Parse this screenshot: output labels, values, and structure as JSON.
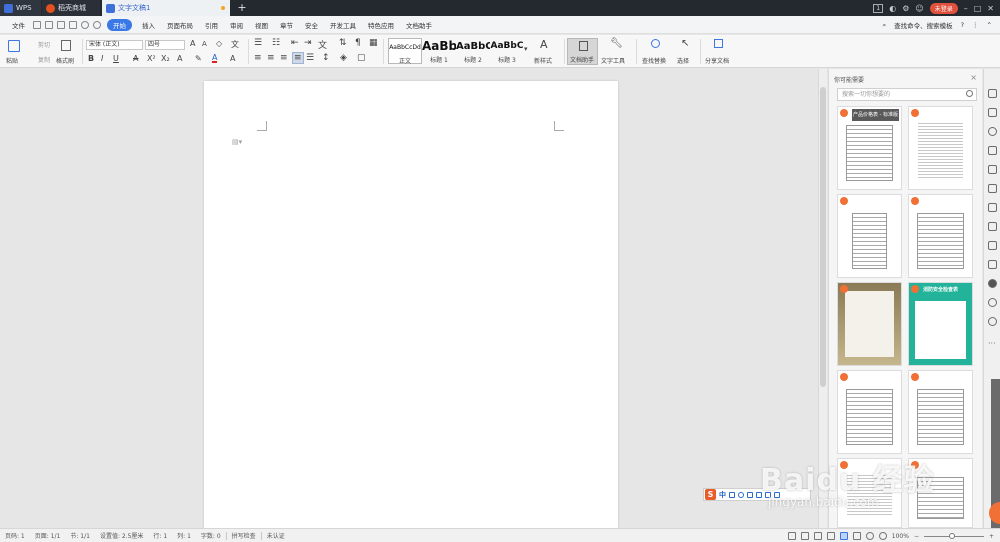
{
  "titlebar": {
    "tabs": [
      {
        "label": "WPS"
      },
      {
        "label": "稻壳商城"
      },
      {
        "label": "文字文稿1"
      }
    ],
    "new_tab": "+",
    "user_badge": "1",
    "login": "未登录"
  },
  "menubar": {
    "file": "文件",
    "items": [
      "开始",
      "插入",
      "页面布局",
      "引用",
      "审阅",
      "视图",
      "章节",
      "安全",
      "开发工具",
      "特色应用",
      "文档助手"
    ],
    "search": "查找命令、搜索模板",
    "help": "?"
  },
  "ribbon": {
    "paste": "粘贴",
    "cut": "剪切",
    "copy": "复制",
    "format_painter": "格式刷",
    "font": "宋体 (正文)",
    "size": "四号",
    "styles": [
      {
        "preview": "AaBbCcDd",
        "name": "正文"
      },
      {
        "preview": "AaBb",
        "name": "标题 1"
      },
      {
        "preview": "AaBbC",
        "name": "标题 2"
      },
      {
        "preview": "AaBbC",
        "name": "标题 3"
      }
    ],
    "new_style": "新样式",
    "doc_assistant": "文档助手",
    "text_tools": "文字工具",
    "find_replace": "查找替换",
    "select": "选择",
    "share": "分享文档"
  },
  "panel": {
    "title": "你可能需要",
    "search_placeholder": "搜索一切你想要的",
    "templates": [
      {
        "header": "产品价格表 - 标准版"
      },
      {
        "header": ""
      },
      {
        "header": ""
      },
      {
        "header": ""
      },
      {
        "header": ""
      },
      {
        "header": "消防安全检查表"
      },
      {
        "header": ""
      },
      {
        "header": ""
      },
      {
        "header": ""
      },
      {
        "header": ""
      }
    ]
  },
  "ime": {
    "logo": "S",
    "mode": "中"
  },
  "watermark": {
    "brand": "Baidu 经验",
    "url": "jingyan.baidu.com"
  },
  "status": {
    "page": "页码: 1",
    "pages": "页面: 1/1",
    "section": "节: 1/1",
    "setting": "设置值: 2.5厘米",
    "row": "行: 1",
    "col": "列: 1",
    "words": "字数: 0",
    "spellcheck": "拼写检查",
    "cert": "未认证",
    "zoom": "100%"
  }
}
